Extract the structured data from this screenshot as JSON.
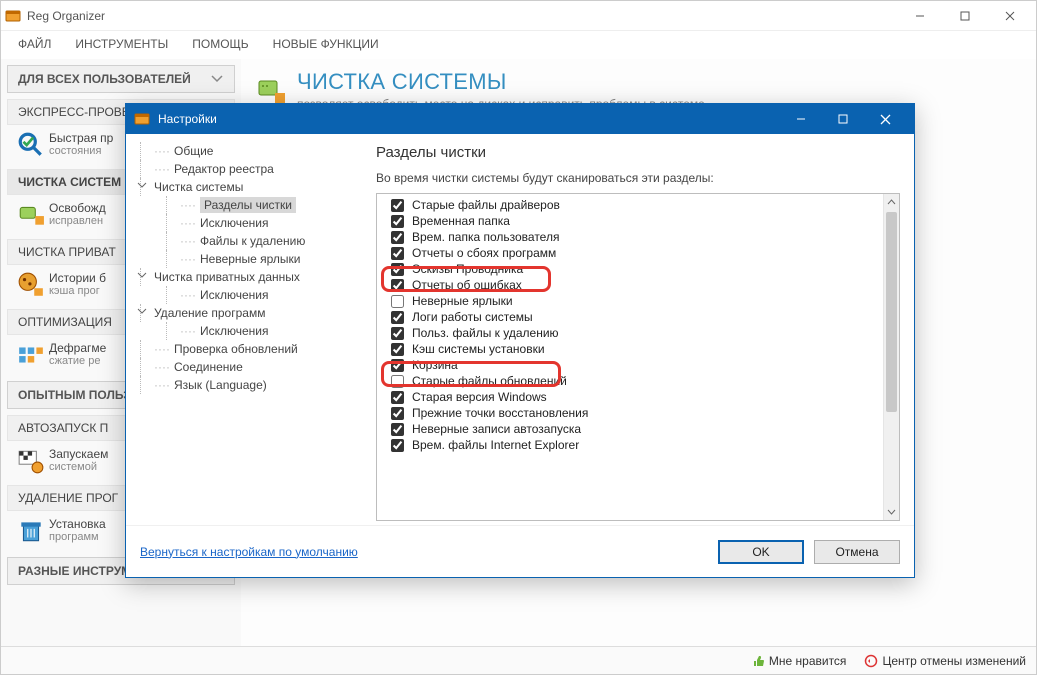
{
  "main_window": {
    "title": "Reg Organizer",
    "menu": [
      "ФАЙЛ",
      "ИНСТРУМЕНТЫ",
      "ПОМОЩЬ",
      "НОВЫЕ ФУНКЦИИ"
    ],
    "user_scope_dd": "ДЛЯ ВСЕХ ПОЛЬЗОВАТЕЛЕЙ",
    "sections": {
      "express": {
        "header": "ЭКСПРЕСС-ПРОВЕРКА",
        "line1": "Быстрая пр",
        "line2": "состояния"
      },
      "clean": {
        "header": "ЧИСТКА СИСТЕМ",
        "line1": "Освобожд",
        "line2": "исправлен"
      },
      "privacy": {
        "header": "ЧИСТКА ПРИВАТ",
        "line1": "Истории б",
        "line2": "кэша прог"
      },
      "opt": {
        "header": "ОПТИМИЗАЦИЯ",
        "line1": "Дефрагме",
        "line2": "сжатие ре"
      },
      "advanced_header": "ОПЫТНЫМ ПОЛЬЗ",
      "autorun": {
        "header": "АВТОЗАПУСК П",
        "line1": "Запускаем",
        "line2": "системой"
      },
      "uninstall": {
        "header": "УДАЛЕНИЕ ПРОГ",
        "line1": "Установка",
        "line2": "программ"
      },
      "misc_header": "РАЗНЫЕ ИНСТРУМ"
    },
    "page": {
      "title": "ЧИСТКА СИСТЕМЫ",
      "subtitle": "позволяет освободить место на дисках и исправить проблемы в системе."
    },
    "status": {
      "like": "Мне нравится",
      "undo": "Центр отмены изменений"
    }
  },
  "dialog": {
    "title": "Настройки",
    "tree": {
      "general": "Общие",
      "regedit": "Редактор реестра",
      "syscleanup": "Чистка системы",
      "sections": "Разделы чистки",
      "exclusions": "Исключения",
      "files_to_delete": "Файлы к удалению",
      "bad_shortcuts": "Неверные ярлыки",
      "privacy_cleanup": "Чистка приватных данных",
      "priv_excl": "Исключения",
      "uninstall": "Удаление программ",
      "uninst_excl": "Исключения",
      "upd_check": "Проверка обновлений",
      "connection": "Соединение",
      "language": "Язык (Language)"
    },
    "pane": {
      "title": "Разделы чистки",
      "desc": "Во время чистки системы будут сканироваться эти разделы:",
      "items": [
        {
          "label": "Старые файлы драйверов",
          "checked": true
        },
        {
          "label": "Временная папка",
          "checked": true
        },
        {
          "label": "Врем. папка пользователя",
          "checked": true
        },
        {
          "label": "Отчеты о сбоях программ",
          "checked": true
        },
        {
          "label": "Эскизы Проводника",
          "checked": true,
          "highlight": true
        },
        {
          "label": "Отчеты об ошибках",
          "checked": true
        },
        {
          "label": "Неверные ярлыки",
          "checked": false
        },
        {
          "label": "Логи работы системы",
          "checked": true
        },
        {
          "label": "Польз. файлы к удалению",
          "checked": true
        },
        {
          "label": "Кэш системы установки",
          "checked": true,
          "highlight": true
        },
        {
          "label": "Корзина",
          "checked": true
        },
        {
          "label": "Старые файлы обновлений",
          "checked": false
        },
        {
          "label": "Старая версия Windows",
          "checked": true
        },
        {
          "label": "Прежние точки восстановления",
          "checked": true
        },
        {
          "label": "Неверные записи автозапуска",
          "checked": true
        },
        {
          "label": "Врем. файлы Internet Explorer",
          "checked": true
        }
      ]
    },
    "footer": {
      "reset": "Вернуться к настройкам по умолчанию",
      "ok": "OK",
      "cancel": "Отмена"
    }
  }
}
